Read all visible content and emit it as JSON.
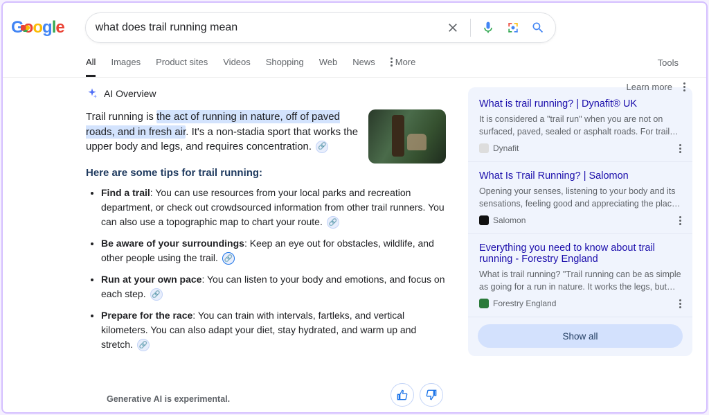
{
  "search": {
    "query": "what does trail running mean"
  },
  "tabs": {
    "all": "All",
    "images": "Images",
    "product": "Product sites",
    "videos": "Videos",
    "shopping": "Shopping",
    "web": "Web",
    "news": "News",
    "more": "More",
    "tools": "Tools"
  },
  "ai": {
    "label": "AI Overview",
    "learn_more": "Learn more",
    "intro_prefix": "Trail running is ",
    "intro_highlight": "the act of running in nature, off of paved roads, and in fresh air",
    "intro_suffix": ". It's a non-stadia sport that works the upper body and legs, and requires concentration.",
    "tips_heading": "Here are some tips for trail running:",
    "tips": [
      {
        "title": "Find a trail",
        "body": ": You can use resources from your local parks and recreation department, or check out crowdsourced information from other trail runners. You can also use a topographic map to chart your route."
      },
      {
        "title": "Be aware of your surroundings",
        "body": ": Keep an eye out for obstacles, wildlife, and other people using the trail."
      },
      {
        "title": "Run at your own pace",
        "body": ": You can listen to your body and emotions, and focus on each step."
      },
      {
        "title": "Prepare for the race",
        "body": ": You can train with intervals, fartleks, and vertical kilometers. You can also adapt your diet, stay hydrated, and warm up and stretch."
      }
    ],
    "disclaimer": "Generative AI is experimental."
  },
  "sources": [
    {
      "title": "What is trail running? | Dynafit® UK",
      "snippet": "It is considered a \"trail run\" when you are not on surfaced, paved, sealed or asphalt roads. For trail running, it's all about…",
      "site": "Dynafit"
    },
    {
      "title": "What Is Trail Running? | Salomon",
      "snippet": "Opening your senses, listening to your body and its sensations, feeling good and appreciating the place where you are runnin…",
      "site": "Salomon"
    },
    {
      "title": "Everything you need to know about trail running - Forestry England",
      "snippet": "What is trail running? \"Trail running can be as simple as going for a run in nature. It works the legs, but also the upper body,…",
      "site": "Forestry England"
    }
  ],
  "sidebar": {
    "show_all": "Show all"
  }
}
